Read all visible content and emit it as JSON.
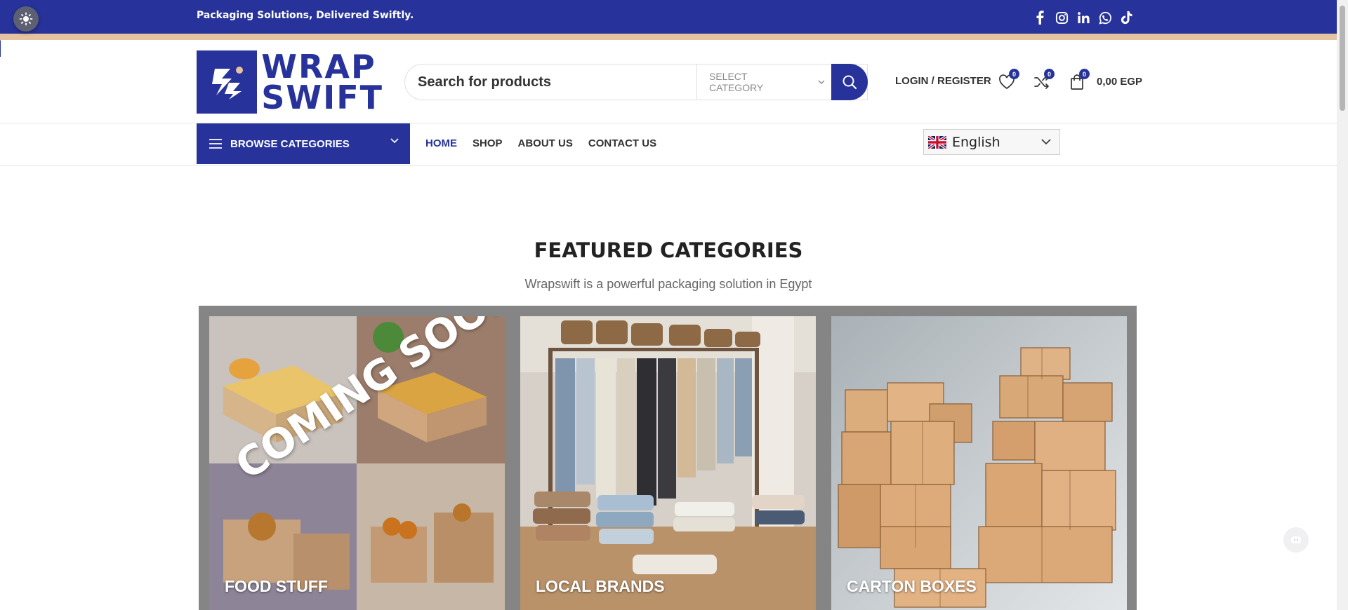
{
  "topbar": {
    "tagline": "Packaging Solutions, Delivered Swiftly.",
    "socials": [
      "facebook-icon",
      "instagram-icon",
      "linkedin-icon",
      "whatsapp-icon",
      "tiktok-icon"
    ],
    "bg_color": "#27339b",
    "stripe_color": "#e6c3a0"
  },
  "logo": {
    "line1": "WRAP",
    "line2": "SWIFT",
    "color": "#27339b"
  },
  "search": {
    "placeholder": "Search for products",
    "category_label": "SELECT CATEGORY"
  },
  "header": {
    "login_label": "LOGIN / REGISTER",
    "wishlist_count": "0",
    "compare_count": "0",
    "cart_count": "0",
    "cart_total": "0,00 EGP"
  },
  "nav": {
    "browse_label": "BROWSE CATEGORIES",
    "items": [
      {
        "label": "HOME",
        "active": true
      },
      {
        "label": "SHOP",
        "active": false
      },
      {
        "label": "ABOUT US",
        "active": false
      },
      {
        "label": "CONTACT US",
        "active": false
      }
    ],
    "language": "English"
  },
  "featured": {
    "title": "FEATURED CATEGORIES",
    "subtitle": "Wrapswift is a powerful packaging solution in Egypt",
    "cards": [
      {
        "label": "FOOD STUFF",
        "overlay": "COMING SOON!"
      },
      {
        "label": "LOCAL BRANDS"
      },
      {
        "label": "CARTON BOXES"
      }
    ]
  }
}
